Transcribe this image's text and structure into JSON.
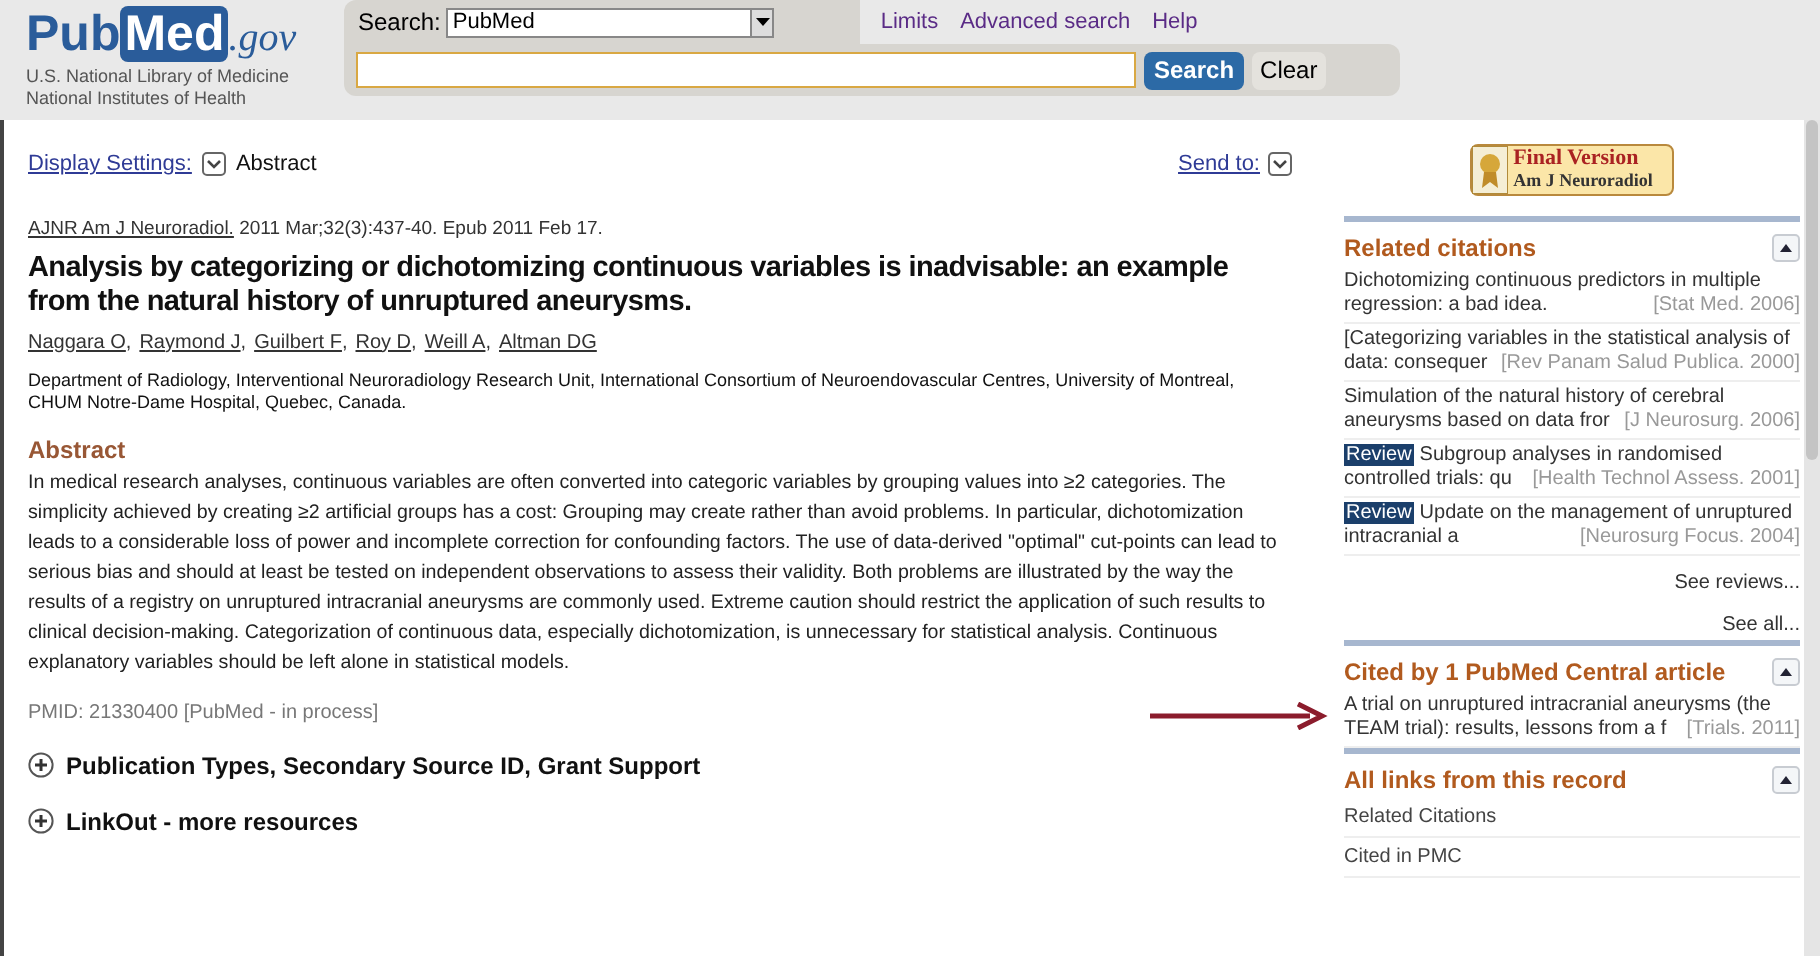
{
  "header": {
    "logo": {
      "pub": "Pub",
      "med": "Med",
      "gov": ".gov"
    },
    "org_lines": [
      "U.S. National Library of Medicine",
      "National Institutes of Health"
    ],
    "search_label": "Search:",
    "database": "PubMed",
    "links": [
      "Limits",
      "Advanced search",
      "Help"
    ],
    "search_button": "Search",
    "clear_button": "Clear"
  },
  "toolbar": {
    "display_settings": "Display Settings:",
    "format": "Abstract",
    "send_to": "Send to:"
  },
  "article": {
    "journal": "AJNR Am J Neuroradiol.",
    "citation": " 2011 Mar;32(3):437-40. Epub 2011 Feb 17.",
    "title": "Analysis by categorizing or dichotomizing continuous variables is inadvisable: an example from the natural history of unruptured aneurysms.",
    "author_separator": ",",
    "authors": [
      "Naggara O",
      "Raymond J",
      "Guilbert F",
      "Roy D",
      "Weill A",
      "Altman DG"
    ],
    "affiliation": "Department of Radiology, Interventional Neuroradiology Research Unit, International Consortium of Neuroendovascular Centres, University of Montreal, CHUM Notre-Dame Hospital, Quebec, Canada.",
    "abstract_heading": "Abstract",
    "abstract": "In medical research analyses, continuous variables are often converted into categoric variables by grouping values into ≥2 categories. The simplicity achieved by creating ≥2 artificial groups has a cost: Grouping may create rather than avoid problems. In particular, dichotomization leads to a considerable loss of power and incomplete correction for confounding factors. The use of data-derived \"optimal\" cut-points can lead to serious bias and should at least be tested on independent observations to assess their validity. Both problems are illustrated by the way the results of a registry on unruptured intracranial aneurysms are commonly used. Extreme caution should restrict the application of such results to clinical decision-making. Categorization of continuous data, especially dichotomization, is unnecessary for statistical analysis. Continuous explanatory variables should be left alone in statistical models.",
    "pmid": "PMID: 21330400 [PubMed - in process]",
    "sections": [
      {
        "label": "Publication Types, Secondary Source ID, Grant Support",
        "expanded": false
      },
      {
        "label": "LinkOut - more resources",
        "expanded": false
      }
    ]
  },
  "sidebar": {
    "final_version": {
      "title": "Final Version",
      "journal": "Am J Neuroradiol"
    },
    "related": {
      "heading": "Related citations",
      "items": [
        {
          "review": false,
          "title": "Dichotomizing continuous predictors in multiple regression: a bad idea.",
          "source": "[Stat Med. 2006]"
        },
        {
          "review": false,
          "title": "[Categorizing variables in the statistical analysis of data: consequer",
          "source": "[Rev Panam Salud Publica. 2000]"
        },
        {
          "review": false,
          "title": "Simulation of the natural history of cerebral aneurysms based on data fror",
          "source": "[J Neurosurg. 2006]"
        },
        {
          "review": true,
          "badge": "Review",
          "title": "Subgroup analyses in randomised controlled trials: qu",
          "source": "[Health Technol Assess. 2001]"
        },
        {
          "review": true,
          "badge": "Review",
          "title": "Update on the management of unruptured intracranial a",
          "source": "[Neurosurg Focus. 2004]"
        }
      ],
      "more_links": [
        "See reviews...",
        "See all..."
      ]
    },
    "cited": {
      "heading": "Cited by 1 PubMed Central article",
      "items": [
        {
          "title": "A trial on unruptured intracranial aneurysms (the TEAM trial): results, lessons from a f",
          "source": "[Trials. 2011]"
        }
      ]
    },
    "all_links": {
      "heading": "All links from this record",
      "items": [
        "Related Citations",
        "Cited in PMC"
      ]
    }
  }
}
